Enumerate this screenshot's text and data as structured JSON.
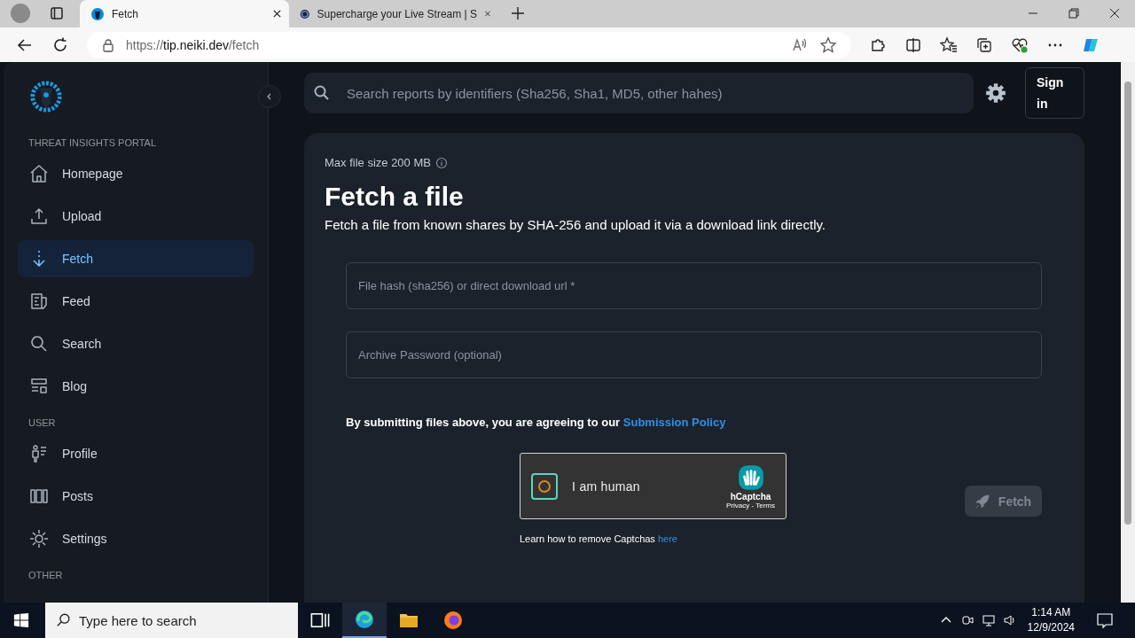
{
  "browser": {
    "tabs": [
      {
        "title": "Fetch",
        "selected": true
      },
      {
        "title": "Supercharge your Live Stream | S",
        "selected": false
      }
    ],
    "url_prefix": "https://",
    "url_host": "tip.neiki.dev",
    "url_path": "/fetch"
  },
  "sidebar": {
    "sections": [
      {
        "heading": "THREAT INSIGHTS PORTAL",
        "items": [
          {
            "label": "Homepage",
            "selected": false
          },
          {
            "label": "Upload",
            "selected": false
          },
          {
            "label": "Fetch",
            "selected": true
          },
          {
            "label": "Feed",
            "selected": false
          },
          {
            "label": "Search",
            "selected": false
          },
          {
            "label": "Blog",
            "selected": false
          }
        ]
      },
      {
        "heading": "USER",
        "items": [
          {
            "label": "Profile",
            "selected": false
          },
          {
            "label": "Posts",
            "selected": false
          },
          {
            "label": "Settings",
            "selected": false
          }
        ]
      },
      {
        "heading": "OTHER"
      }
    ]
  },
  "header": {
    "search_placeholder": "Search reports by identifiers (Sha256, Sha1, MD5, other hahes)",
    "sign_in": "Sign in"
  },
  "card": {
    "note": "Max file size 200 MB",
    "title": "Fetch a file",
    "subtitle": "Fetch a file from known shares by SHA-256 and upload it via a download link directly.",
    "fields": [
      {
        "placeholder": "File hash (sha256) or direct download url *"
      },
      {
        "placeholder": "Archive Password (optional)"
      }
    ],
    "policy_text": "By submitting files above, you are agreeing to our",
    "policy_link": "Submission Policy",
    "captcha": {
      "label": "I am human",
      "checked": false,
      "brand": "hCaptcha",
      "links": "Privacy - Terms"
    },
    "help_text": "Learn how to remove Captchas",
    "help_link": "here",
    "button": {
      "label": "Fetch",
      "disabled": true
    }
  },
  "taskbar": {
    "search_placeholder": "Type here to search",
    "time": "1:14 AM",
    "date": "12/9/2024"
  }
}
